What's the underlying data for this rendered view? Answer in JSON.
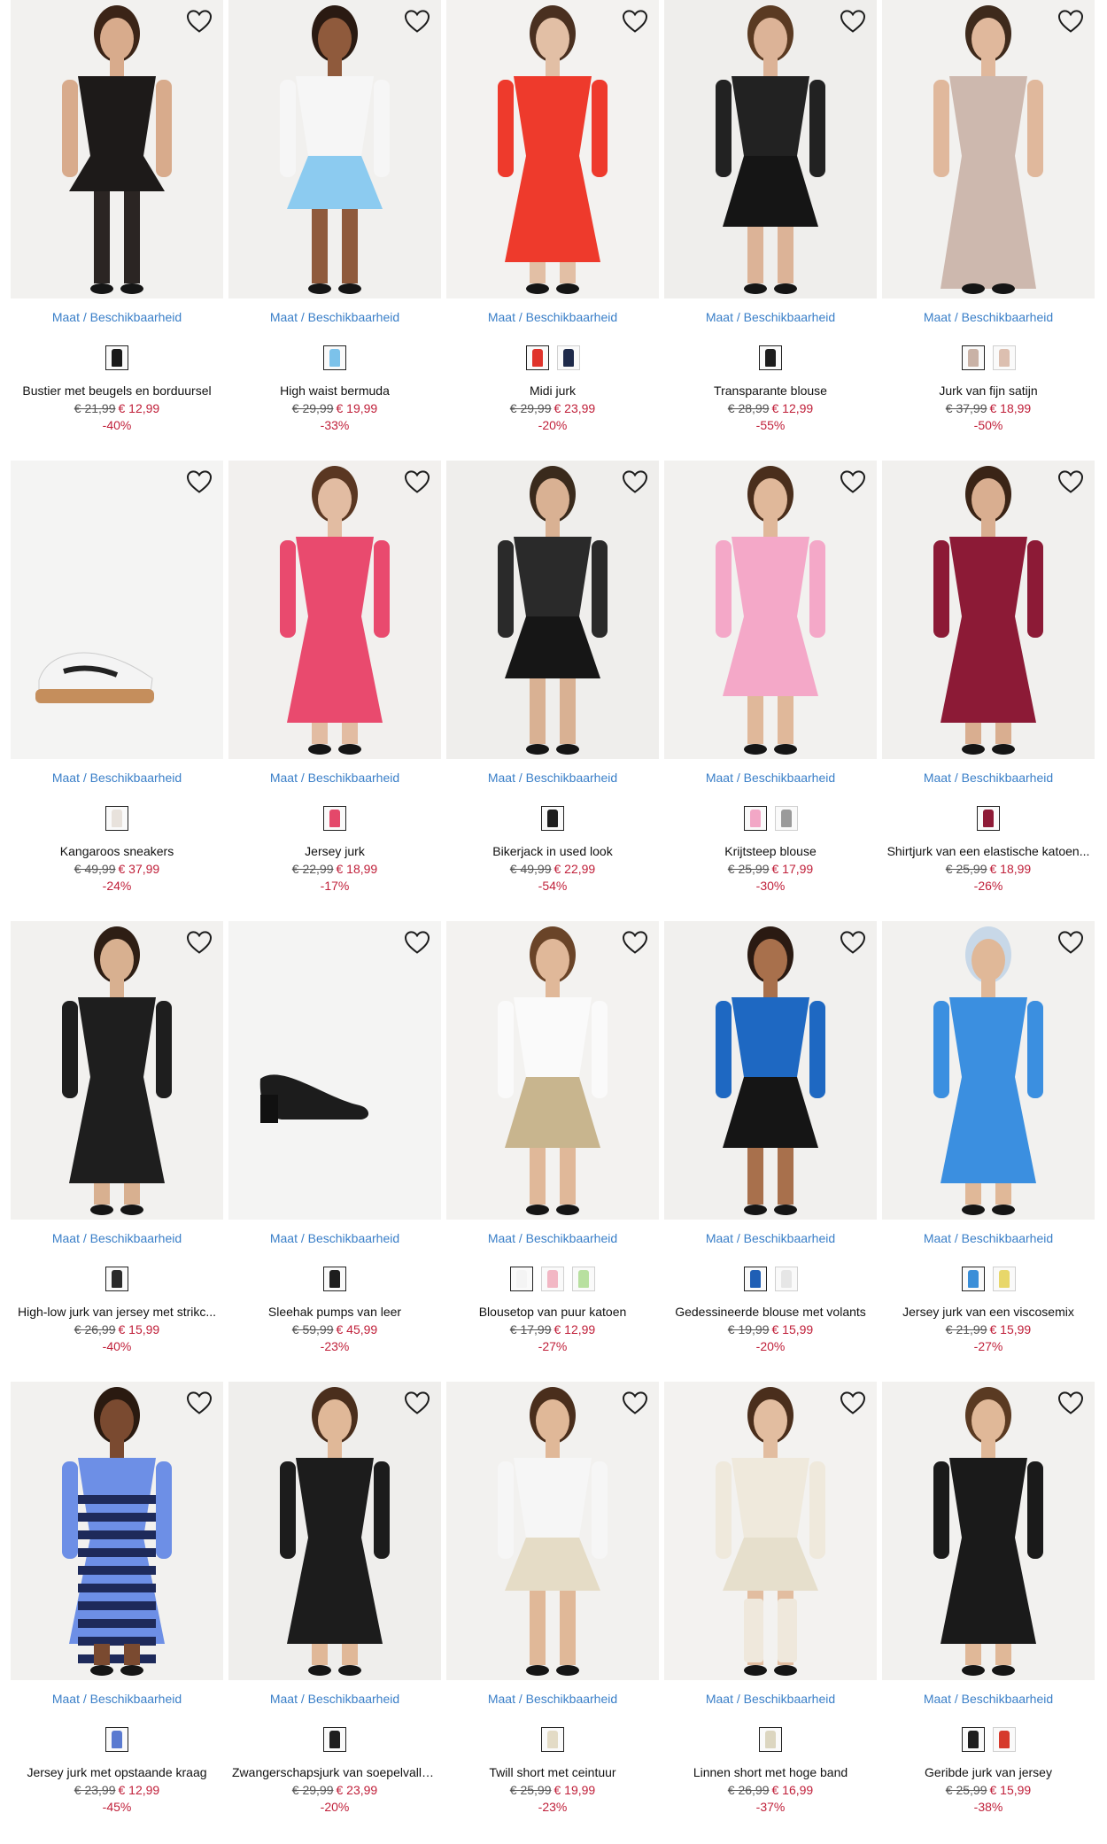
{
  "labels": {
    "availability": "Maat / Beschikbaarheid"
  },
  "products": [
    {
      "name": "Bustier met beugels en borduursel",
      "old_price": "€ 21,99",
      "new_price": "€ 12,99",
      "discount": "-40%",
      "swatches": [
        "#1a1a1a"
      ],
      "bg": "#f2f1ef",
      "cloth": "#1d1a19",
      "skin": "#d8ab8c",
      "hair": "#3b2417",
      "kind": "lingerie"
    },
    {
      "name": "High waist bermuda",
      "old_price": "€ 29,99",
      "new_price": "€ 19,99",
      "discount": "-33%",
      "swatches": [
        "#7cc2ea"
      ],
      "bg": "#f1f0ee",
      "cloth": "#8ccbf0",
      "skin": "#8f5a3c",
      "hair": "#2a1a12",
      "kind": "shorts"
    },
    {
      "name": "Midi jurk",
      "old_price": "€ 29,99",
      "new_price": "€ 23,99",
      "discount": "-20%",
      "swatches": [
        "#e0332b",
        "#1e2a4a"
      ],
      "bg": "#f3f2f0",
      "cloth": "#ee3a2c",
      "skin": "#e2bfa5",
      "hair": "#4a3020",
      "kind": "dress"
    },
    {
      "name": "Transparante blouse",
      "old_price": "€ 28,99",
      "new_price": "€ 12,99",
      "discount": "-55%",
      "swatches": [
        "#1c1c1c"
      ],
      "bg": "#efeeec",
      "cloth": "#222222",
      "skin": "#dcb397",
      "hair": "#5a3a22",
      "kind": "top"
    },
    {
      "name": "Jurk van fijn satijn",
      "old_price": "€ 37,99",
      "new_price": "€ 18,99",
      "discount": "-50%",
      "swatches": [
        "#c9b2a6",
        "#dcbfb0"
      ],
      "bg": "#f2f1ef",
      "cloth": "#cdb8ae",
      "skin": "#e0b89c",
      "hair": "#3e2a1c",
      "kind": "slip"
    },
    {
      "name": "Kangaroos sneakers",
      "old_price": "€ 49,99",
      "new_price": "€ 37,99",
      "discount": "-24%",
      "swatches": [
        "#e8e2dc"
      ],
      "bg": "#f4f4f3",
      "cloth": "#f4f4f4",
      "skin": "#c89a6a",
      "hair": "#1e1e1e",
      "kind": "sneaker"
    },
    {
      "name": "Jersey jurk",
      "old_price": "€ 22,99",
      "new_price": "€ 18,99",
      "discount": "-17%",
      "swatches": [
        "#e4486a"
      ],
      "bg": "#f2f0ee",
      "cloth": "#e94a6e",
      "skin": "#e2bca2",
      "hair": "#5a3722",
      "kind": "dress"
    },
    {
      "name": "Bikerjack in used look",
      "old_price": "€ 49,99",
      "new_price": "€ 22,99",
      "discount": "-54%",
      "swatches": [
        "#1e1e1e"
      ],
      "bg": "#efeeec",
      "cloth": "#2a2a2a",
      "skin": "#d9b193",
      "hair": "#3a2a1c",
      "kind": "jacket"
    },
    {
      "name": "Krijtsteep blouse",
      "old_price": "€ 25,99",
      "new_price": "€ 17,99",
      "discount": "-30%",
      "swatches": [
        "#f2a7c6",
        "#9a9a9a"
      ],
      "bg": "#f2f1ef",
      "cloth": "#f4a8c8",
      "skin": "#e0b89a",
      "hair": "#4a2e1c",
      "kind": "suit"
    },
    {
      "name": "Shirtjurk van een elastische katoen...",
      "old_price": "€ 25,99",
      "new_price": "€ 18,99",
      "discount": "-26%",
      "swatches": [
        "#8e1a36"
      ],
      "bg": "#f1f0ee",
      "cloth": "#8c1a36",
      "skin": "#d9ae90",
      "hair": "#3a2416",
      "kind": "dress"
    },
    {
      "name": "High-low jurk van jersey met strikc...",
      "old_price": "€ 26,99",
      "new_price": "€ 15,99",
      "discount": "-40%",
      "swatches": [
        "#2a2a2a"
      ],
      "bg": "#f2f1ef",
      "cloth": "#1e1e1e",
      "skin": "#d8b090",
      "hair": "#2e1e14",
      "kind": "dress"
    },
    {
      "name": "Sleehak pumps van leer",
      "old_price": "€ 59,99",
      "new_price": "€ 45,99",
      "discount": "-23%",
      "swatches": [
        "#1e1e1e"
      ],
      "bg": "#f4f4f3",
      "cloth": "#1c1c1c",
      "skin": "#c89a6a",
      "hair": "#1e1e1e",
      "kind": "pump"
    },
    {
      "name": "Blousetop van puur katoen",
      "old_price": "€ 17,99",
      "new_price": "€ 12,99",
      "discount": "-27%",
      "swatches": [
        "#f4f4f4",
        "#f2b7c4",
        "#b8e0a0"
      ],
      "bg": "#f3f2f0",
      "cloth": "#fafafa",
      "skin": "#e0b899",
      "hair": "#6a4428",
      "kind": "top-light"
    },
    {
      "name": "Gedessineerde blouse met volants",
      "old_price": "€ 19,99",
      "new_price": "€ 15,99",
      "discount": "-20%",
      "swatches": [
        "#1f5fb5",
        "#e6e6e6"
      ],
      "bg": "#f1f0ee",
      "cloth": "#1e68c2",
      "skin": "#a8704c",
      "hair": "#2a1a12",
      "kind": "top"
    },
    {
      "name": "Jersey jurk van een viscosemix",
      "old_price": "€ 21,99",
      "new_price": "€ 15,99",
      "discount": "-27%",
      "swatches": [
        "#3a8ed8",
        "#e8d76a"
      ],
      "bg": "#f2f1ef",
      "cloth": "#3b8fe0",
      "skin": "#e0b898",
      "hair": "#c8d8e8",
      "kind": "dress"
    },
    {
      "name": "Jersey jurk met opstaande kraag",
      "old_price": "€ 23,99",
      "new_price": "€ 12,99",
      "discount": "-45%",
      "swatches": [
        "#5a7ad0"
      ],
      "bg": "#f2f1ef",
      "cloth": "#6d8fe6",
      "skin": "#7a4a30",
      "hair": "#2a1a10",
      "kind": "stripe"
    },
    {
      "name": "Zwangerschapsjurk van soepelvalle...",
      "old_price": "€ 29,99",
      "new_price": "€ 23,99",
      "discount": "-20%",
      "swatches": [
        "#1e1e1e"
      ],
      "bg": "#efeeec",
      "cloth": "#1c1c1c",
      "skin": "#e0b898",
      "hair": "#4a2e1c",
      "kind": "dress"
    },
    {
      "name": "Twill short met ceintuur",
      "old_price": "€ 25,99",
      "new_price": "€ 19,99",
      "discount": "-23%",
      "swatches": [
        "#e3dbc6"
      ],
      "bg": "#f2f1ef",
      "cloth": "#e5dcc6",
      "skin": "#e0b898",
      "hair": "#4a2e1c",
      "kind": "shorts"
    },
    {
      "name": "Linnen short met hoge band",
      "old_price": "€ 26,99",
      "new_price": "€ 16,99",
      "discount": "-37%",
      "swatches": [
        "#dcd6c0"
      ],
      "bg": "#f3f2f0",
      "cloth": "#e6dfcc",
      "skin": "#e2bda0",
      "hair": "#4a2e1c",
      "kind": "shorts-boots"
    },
    {
      "name": "Geribde jurk van jersey",
      "old_price": "€ 25,99",
      "new_price": "€ 15,99",
      "discount": "-38%",
      "swatches": [
        "#1e1e1e",
        "#d63a2c"
      ],
      "bg": "#f2f1ef",
      "cloth": "#1a1a1a",
      "skin": "#e0b898",
      "hair": "#5a3a22",
      "kind": "dress"
    }
  ]
}
